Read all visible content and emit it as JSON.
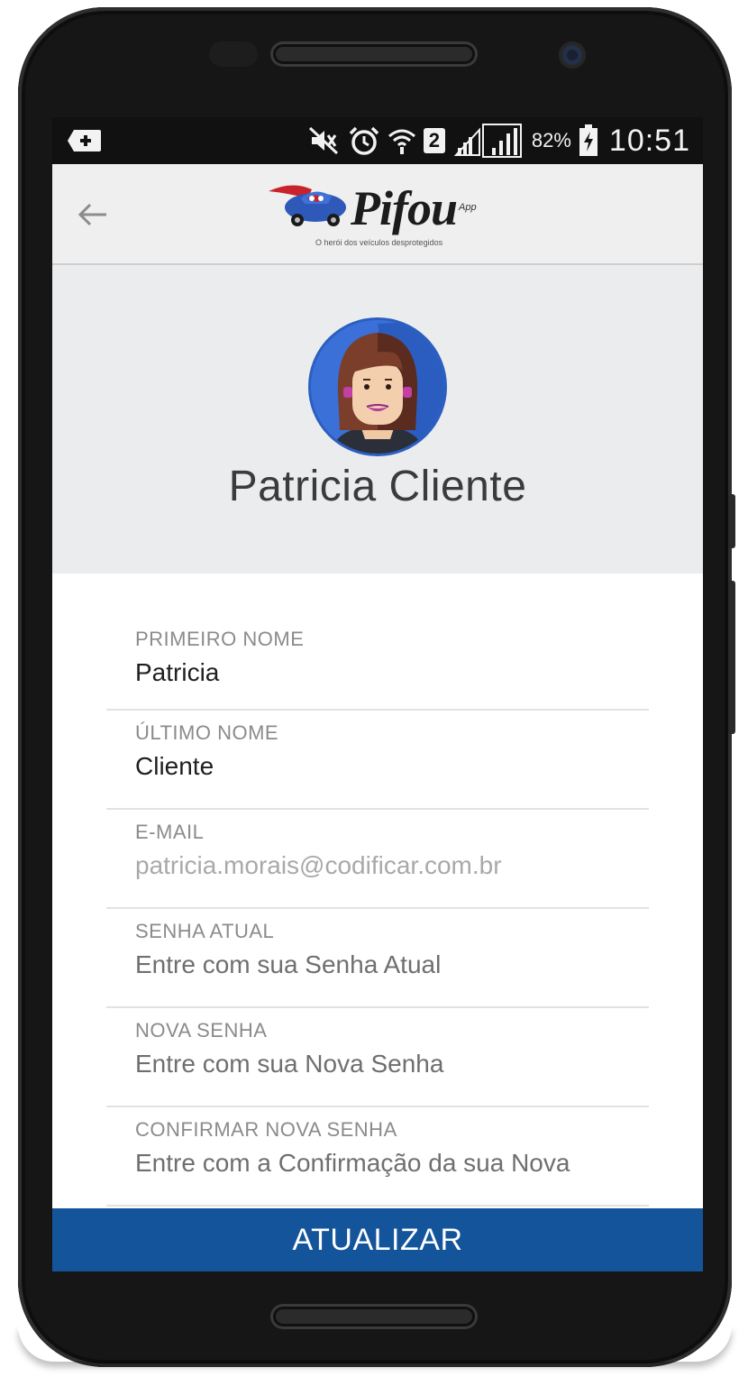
{
  "status_bar": {
    "signal_badge": "2",
    "battery_percent": "82%",
    "time": "10:51"
  },
  "app_bar": {
    "brand_name": "Pifou",
    "brand_suffix": "App",
    "tagline": "O herói dos veículos desprotegidos"
  },
  "profile": {
    "name": "Patricia Cliente"
  },
  "form": {
    "fields": [
      {
        "label": "PRIMEIRO NOME",
        "value": "Patricia"
      },
      {
        "label": "ÚLTIMO NOME",
        "value": "Cliente"
      },
      {
        "label": "E-MAIL",
        "value": "patricia.morais@codificar.com.br"
      },
      {
        "label": "SENHA ATUAL",
        "placeholder": "Entre com sua Senha Atual"
      },
      {
        "label": "NOVA SENHA",
        "placeholder": "Entre com sua Nova Senha"
      },
      {
        "label": "CONFIRMAR NOVA SENHA",
        "placeholder": "Entre com a Confirmação da sua Nova"
      }
    ]
  },
  "actions": {
    "update_label": "ATUALIZAR"
  },
  "colors": {
    "primary": "#14549a",
    "avatar_bg": "#3a70d8",
    "header_bg": "#efefef",
    "profile_bg": "#ebecee"
  }
}
